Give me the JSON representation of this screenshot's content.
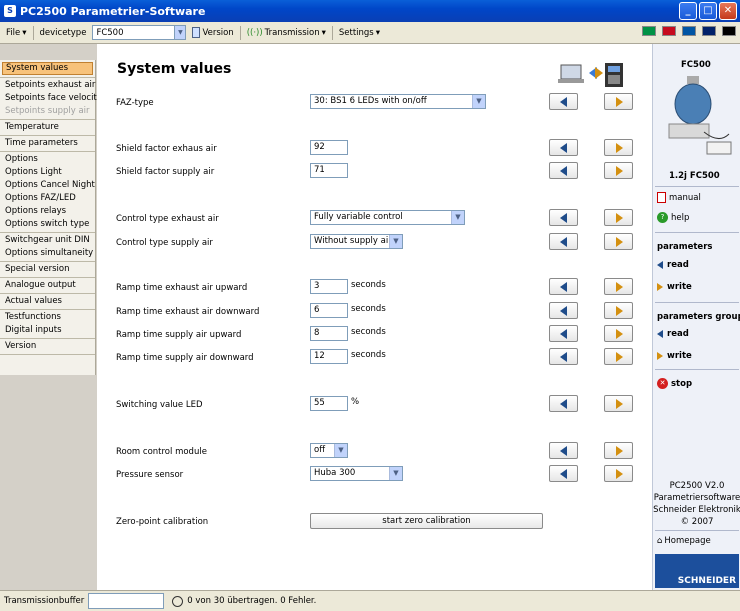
{
  "window": {
    "title": "PC2500 Parametrier-Software",
    "icon_text": "S"
  },
  "toolbar": {
    "file": "File",
    "devicetype_label": "devicetype",
    "devicetype_value": "FC500",
    "version": "Version",
    "transmission": "Transmission",
    "settings": "Settings",
    "flags": [
      "#009246",
      "#c60b1e",
      "#0055a4",
      "#012169",
      "#000000"
    ]
  },
  "sidebar": {
    "groups": [
      [
        {
          "label": "System values",
          "state": "active"
        }
      ],
      [
        {
          "label": "Setpoints exhaust air",
          "state": "normal"
        },
        {
          "label": "Setpoints face velocity",
          "state": "normal"
        },
        {
          "label": "Setpoints supply air",
          "state": "disabled"
        }
      ],
      [
        {
          "label": "Temperature",
          "state": "normal"
        }
      ],
      [
        {
          "label": "Time parameters",
          "state": "normal"
        }
      ],
      [
        {
          "label": "Options",
          "state": "normal"
        },
        {
          "label": "Options Light",
          "state": "normal"
        },
        {
          "label": "Options Cancel Night",
          "state": "normal"
        },
        {
          "label": "Options FAZ/LED",
          "state": "normal"
        },
        {
          "label": "Options relays",
          "state": "normal"
        },
        {
          "label": "Options switch type",
          "state": "normal"
        }
      ],
      [
        {
          "label": "Switchgear unit DIN",
          "state": "normal"
        },
        {
          "label": "Options simultaneity",
          "state": "normal"
        }
      ],
      [
        {
          "label": "Special version",
          "state": "normal"
        }
      ],
      [
        {
          "label": "Analogue output",
          "state": "normal"
        }
      ],
      [
        {
          "label": "Actual values",
          "state": "normal"
        }
      ],
      [
        {
          "label": "Testfunctions",
          "state": "normal"
        },
        {
          "label": "Digital inputs",
          "state": "normal"
        }
      ],
      [
        {
          "label": "Version",
          "state": "normal"
        }
      ]
    ]
  },
  "main": {
    "title": "System values",
    "fields": {
      "faz_type": {
        "label": "FAZ-type",
        "value": "30: BS1 6 LEDs  with on/off"
      },
      "shield_exhaust": {
        "label": "Shield factor exhaus air",
        "value": "92"
      },
      "shield_supply": {
        "label": "Shield factor supply air",
        "value": "71"
      },
      "ctrl_exhaust": {
        "label": "Control type exhaust air",
        "value": "Fully variable control"
      },
      "ctrl_supply": {
        "label": "Control type supply air",
        "value": "Without supply air"
      },
      "ramp_ex_up": {
        "label": "Ramp time exhaust air upward",
        "value": "3",
        "unit": "seconds"
      },
      "ramp_ex_down": {
        "label": "Ramp time exhaust air downward",
        "value": "6",
        "unit": "seconds"
      },
      "ramp_su_up": {
        "label": "Ramp time supply air upward",
        "value": "8",
        "unit": "seconds"
      },
      "ramp_su_down": {
        "label": "Ramp time supply air downward",
        "value": "12",
        "unit": "seconds"
      },
      "switch_led": {
        "label": "Switching value LED",
        "value": "55",
        "unit": "%"
      },
      "room_ctrl": {
        "label": "Room control module",
        "value": "off"
      },
      "pressure": {
        "label": "Pressure sensor",
        "value": "Huba 300"
      },
      "zero_cal": {
        "label": "Zero-point calibration",
        "button": "start zero calibration"
      }
    }
  },
  "right": {
    "device_title": "FC500",
    "device_caption": "1.2j  FC500",
    "manual": "manual",
    "help": "help",
    "parameters": "parameters",
    "read": "read",
    "write": "write",
    "parameters_group": "parameters group",
    "read2": "read",
    "write2": "write",
    "stop": "stop",
    "info1": "PC2500 V2.0",
    "info2": "Parametriersoftware",
    "info3": "Schneider Elektronik",
    "info4": "© 2007",
    "homepage": "Homepage",
    "logo": "SCHNEIDER"
  },
  "status": {
    "buffer_label": "Transmissionbuffer",
    "message": "0 von 30 übertragen. 0 Fehler."
  }
}
